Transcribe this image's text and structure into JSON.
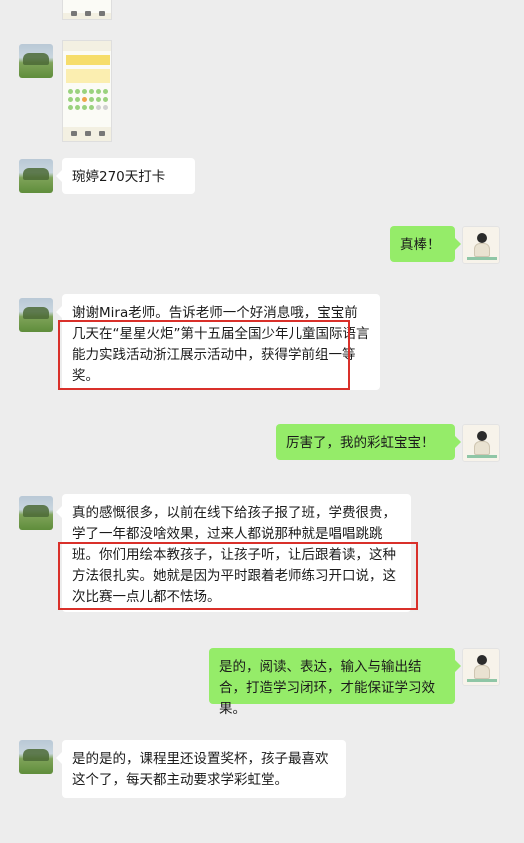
{
  "colors": {
    "background": "#ededed",
    "sent_bubble": "#95ec69",
    "received_bubble": "#ffffff",
    "highlight_box": "#d9302a"
  },
  "messages": [
    {
      "id": "m1",
      "side": "left",
      "type": "image",
      "content": "checkin-calendar-screenshot"
    },
    {
      "id": "m2",
      "side": "left",
      "type": "text",
      "text": "琬婷270天打卡"
    },
    {
      "id": "m3",
      "side": "right",
      "type": "text",
      "text": "真棒！"
    },
    {
      "id": "m4",
      "side": "left",
      "type": "text",
      "text": "谢谢Mira老师。告诉老师一个好消息哦，宝宝前几天在“星星火炬”第十五届全国少年儿童国际语言能力实践活动浙江展示活动中，获得学前组一等奖。"
    },
    {
      "id": "m5",
      "side": "right",
      "type": "text",
      "text": "厉害了，我的彩虹宝宝！"
    },
    {
      "id": "m6",
      "side": "left",
      "type": "text",
      "text": "真的感慨很多，以前在线下给孩子报了班，学费很贵，学了一年都没啥效果，过来人都说那种就是唱唱跳跳班。你们用绘本教孩子，让孩子听，让后跟着读，这种方法很扎实。她就是因为平时跟着老师练习开口说，这次比赛一点儿都不怯场。"
    },
    {
      "id": "m7",
      "side": "right",
      "type": "text",
      "text": "是的，阅读、表达，输入与输出结合，打造学习闭环，才能保证学习效果。"
    },
    {
      "id": "m8",
      "side": "left",
      "type": "text",
      "text": "是的是的，课程里还设置奖杯，孩子最喜欢这个了，每天都主动要求学彩虹堂。"
    }
  ]
}
